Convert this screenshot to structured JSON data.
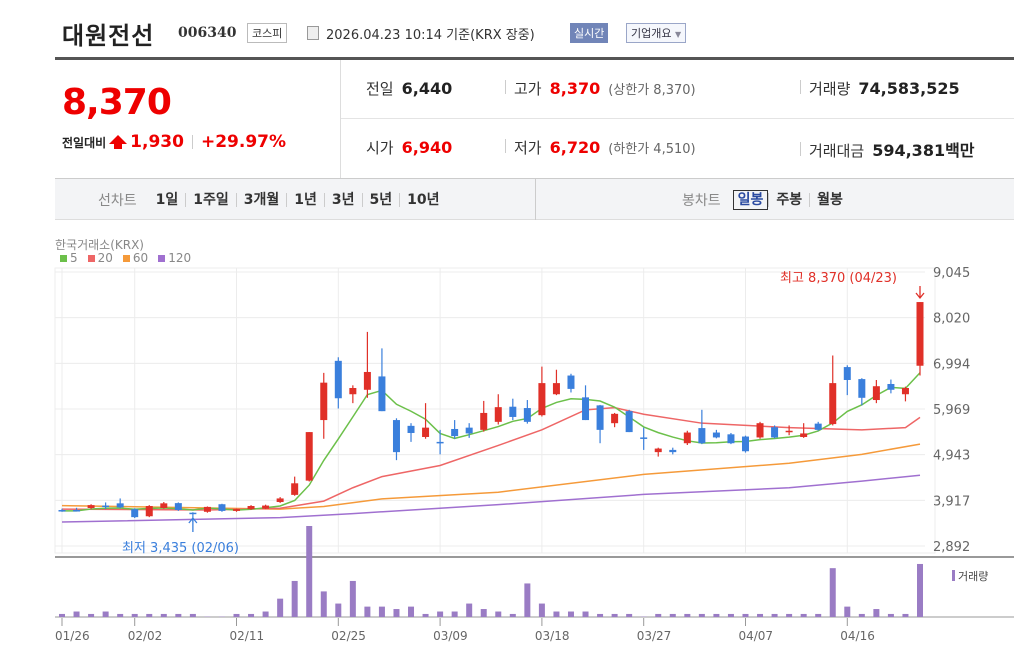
{
  "header": {
    "name": "대원전선",
    "code": "006340",
    "market": "코스피",
    "datetime": "2026.04.23 10:14",
    "basis": "기준(KRX 장중)",
    "realtime_btn": "실시간",
    "company_btn": "기업개요"
  },
  "price": {
    "current": "8,370",
    "change_label": "전일대비",
    "change": "1,930",
    "change_pct": "+29.97%"
  },
  "stats": {
    "prev": {
      "k": "전일",
      "v": "6,440"
    },
    "high": {
      "k": "고가",
      "v": "8,370",
      "sub": "(상한가 8,370)"
    },
    "volume": {
      "k": "거래량",
      "v": "74,583,525"
    },
    "open": {
      "k": "시가",
      "v": "6,940"
    },
    "low": {
      "k": "저가",
      "v": "6,720",
      "sub": "(하한가 4,510)"
    },
    "value": {
      "k": "거래대금",
      "v": "594,381",
      "unit": "백만"
    }
  },
  "tabs": {
    "line_label": "선차트",
    "line": [
      "1일",
      "1주일",
      "3개월",
      "1년",
      "3년",
      "5년",
      "10년"
    ],
    "candle_label": "봉차트",
    "candle": [
      "일봉",
      "주봉",
      "월봉"
    ],
    "selected": "일봉"
  },
  "colors": {
    "up": "#e03028",
    "down": "#3a7fdc",
    "ma5": "#6cc04a",
    "ma20": "#ee6666",
    "ma60": "#f59a3a",
    "ma120": "#a070d0",
    "volume": "#9a7cc4"
  },
  "chart_data": {
    "type": "candlestick",
    "source": "한국거래소(KRX)",
    "legend": [
      "5",
      "20",
      "60",
      "120"
    ],
    "y_ticks": [
      9045,
      8020,
      6994,
      5969,
      4943,
      3917,
      2892
    ],
    "ylim": [
      2892,
      9045
    ],
    "x_ticks": [
      {
        "i": 0,
        "label": "01/26"
      },
      {
        "i": 5,
        "label": "02/02"
      },
      {
        "i": 12,
        "label": "02/11"
      },
      {
        "i": 19,
        "label": "02/25"
      },
      {
        "i": 26,
        "label": "03/09"
      },
      {
        "i": 33,
        "label": "03/18"
      },
      {
        "i": 40,
        "label": "03/27"
      },
      {
        "i": 47,
        "label": "04/07"
      },
      {
        "i": 54,
        "label": "04/16"
      }
    ],
    "high_note": "최고 8,370 (04/23)",
    "low_note": "최저 3,435 (02/06)",
    "low_index": 9,
    "volume_label": "거래량",
    "ohlc": [
      [
        3700,
        3730,
        3660,
        3680
      ],
      [
        3700,
        3750,
        3670,
        3680
      ],
      [
        3745,
        3830,
        3720,
        3810
      ],
      [
        3800,
        3870,
        3720,
        3790
      ],
      [
        3850,
        3960,
        3740,
        3760
      ],
      [
        3720,
        3740,
        3520,
        3540
      ],
      [
        3560,
        3810,
        3540,
        3790
      ],
      [
        3745,
        3880,
        3730,
        3850
      ],
      [
        3855,
        3870,
        3680,
        3700
      ],
      [
        3640,
        3650,
        3435,
        3620
      ],
      [
        3660,
        3780,
        3640,
        3770
      ],
      [
        3830,
        3840,
        3660,
        3680
      ],
      [
        3680,
        3730,
        3660,
        3720
      ],
      [
        3720,
        3810,
        3700,
        3790
      ],
      [
        3730,
        3820,
        3720,
        3800
      ],
      [
        3880,
        3990,
        3860,
        3960
      ],
      [
        4040,
        4450,
        4020,
        4300
      ],
      [
        4360,
        5450,
        4340,
        5450
      ],
      [
        5720,
        6780,
        5300,
        6560
      ],
      [
        7050,
        7130,
        5980,
        6210
      ],
      [
        6300,
        6500,
        6100,
        6440
      ],
      [
        6400,
        7700,
        6220,
        6800
      ],
      [
        6700,
        7330,
        5920,
        5920
      ],
      [
        5720,
        5760,
        4820,
        5000
      ],
      [
        5590,
        5650,
        5230,
        5430
      ],
      [
        5340,
        6100,
        5300,
        5550
      ],
      [
        5230,
        5500,
        4950,
        5200
      ],
      [
        5520,
        5720,
        5300,
        5360
      ],
      [
        5550,
        5650,
        5320,
        5420
      ],
      [
        5500,
        6150,
        5460,
        5880
      ],
      [
        5680,
        6300,
        5620,
        6010
      ],
      [
        6020,
        6200,
        5720,
        5790
      ],
      [
        5990,
        6170,
        5640,
        5680
      ],
      [
        5830,
        6920,
        5800,
        6550
      ],
      [
        6300,
        6850,
        6280,
        6550
      ],
      [
        6720,
        6760,
        6340,
        6420
      ],
      [
        6230,
        6500,
        5720,
        5720
      ],
      [
        6050,
        6060,
        5200,
        5500
      ],
      [
        5650,
        5880,
        5560,
        5860
      ],
      [
        5920,
        5950,
        5450,
        5450
      ],
      [
        5330,
        5550,
        5050,
        5300
      ],
      [
        5000,
        5100,
        4900,
        5080
      ],
      [
        5050,
        5100,
        4950,
        5000
      ],
      [
        5200,
        5480,
        5160,
        5440
      ],
      [
        5540,
        5950,
        5180,
        5200
      ],
      [
        5440,
        5500,
        5310,
        5330
      ],
      [
        5400,
        5430,
        5180,
        5200
      ],
      [
        5350,
        5370,
        4990,
        5020
      ],
      [
        5330,
        5680,
        5300,
        5650
      ],
      [
        5560,
        5600,
        5310,
        5330
      ],
      [
        5460,
        5600,
        5380,
        5480
      ],
      [
        5340,
        5650,
        5320,
        5420
      ],
      [
        5640,
        5680,
        5480,
        5500
      ],
      [
        5630,
        7170,
        5600,
        6550
      ],
      [
        6910,
        6950,
        6280,
        6620
      ],
      [
        6640,
        6660,
        6050,
        6220
      ],
      [
        6170,
        6620,
        6100,
        6480
      ],
      [
        6530,
        6630,
        6320,
        6400
      ],
      [
        6300,
        6470,
        6140,
        6440
      ],
      [
        6940,
        8370,
        6720,
        8370
      ]
    ],
    "volume_millions": [
      4.3,
      7.7,
      4.3,
      7.7,
      4.3,
      4.3,
      4.3,
      4.3,
      4.3,
      4.3,
      0.5,
      0.5,
      4.3,
      4.3,
      7.7,
      25.8,
      50.7,
      128,
      36,
      18.9,
      50.7,
      14.6,
      14.6,
      11.2,
      14.6,
      4.3,
      7.7,
      7.7,
      18.9,
      11.2,
      7.7,
      4.3,
      47.2,
      18.9,
      7.7,
      7.7,
      7.7,
      4.3,
      4.3,
      4.3,
      0.5,
      4.3,
      4.3,
      4.3,
      4.3,
      4.3,
      4.3,
      4.3,
      4.3,
      4.3,
      4.3,
      4.3,
      4.3,
      68.7,
      14.6,
      4.3,
      11.2,
      4.3,
      4.3,
      74.6
    ],
    "ma20": [
      [
        0,
        3720
      ],
      [
        10,
        3700
      ],
      [
        15,
        3740
      ],
      [
        18,
        3900
      ],
      [
        20,
        4200
      ],
      [
        22,
        4450
      ],
      [
        26,
        4700
      ],
      [
        30,
        5150
      ],
      [
        33,
        5500
      ],
      [
        36,
        5950
      ],
      [
        38,
        6000
      ],
      [
        40,
        5850
      ],
      [
        44,
        5650
      ],
      [
        50,
        5550
      ],
      [
        55,
        5500
      ],
      [
        58,
        5550
      ],
      [
        59,
        5780
      ]
    ],
    "ma60": [
      [
        0,
        3800
      ],
      [
        15,
        3720
      ],
      [
        18,
        3780
      ],
      [
        22,
        3950
      ],
      [
        30,
        4100
      ],
      [
        40,
        4500
      ],
      [
        50,
        4750
      ],
      [
        55,
        4950
      ],
      [
        59,
        5180
      ]
    ],
    "ma120": [
      [
        0,
        3430
      ],
      [
        15,
        3530
      ],
      [
        20,
        3620
      ],
      [
        30,
        3820
      ],
      [
        40,
        4050
      ],
      [
        50,
        4200
      ],
      [
        55,
        4350
      ],
      [
        59,
        4480
      ]
    ]
  }
}
